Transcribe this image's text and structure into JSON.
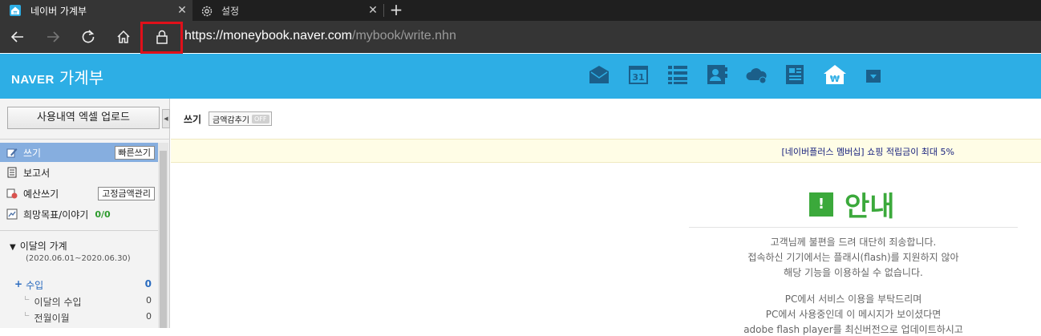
{
  "browser": {
    "tabs": [
      {
        "title": "네이버 가계부",
        "close": "✕"
      },
      {
        "title": "설정",
        "close": "✕"
      }
    ],
    "new_tab": "+",
    "url_host": "https://moneybook.naver.com",
    "url_path": "/mybook/write.nhn"
  },
  "header": {
    "brand": "NAVER",
    "product": "가계부",
    "icons": [
      "mail-icon",
      "calendar-icon",
      "list-icon",
      "contact-icon",
      "cloud-icon",
      "film-icon",
      "home-won-icon",
      "dropdown-icon"
    ],
    "calendar_day": "31",
    "home_symbol": "₩",
    "accent": "#2daee5"
  },
  "sidebar": {
    "upload_button": "사용내역 엑셀 업로드",
    "menu": [
      {
        "label": "쓰기",
        "button": "빠른쓰기"
      },
      {
        "label": "보고서"
      },
      {
        "label": "예산쓰기",
        "button": "고정금액관리"
      },
      {
        "label": "희망목표/이야기",
        "count": "0/0"
      }
    ],
    "month": {
      "title": "이달의 가계",
      "range": "(2020.06.01~2020.06.30)",
      "rows": [
        {
          "label": "수입",
          "value": "0"
        },
        {
          "label": "이달의 수입",
          "value": "0"
        },
        {
          "label": "전월이월",
          "value": "0"
        }
      ]
    }
  },
  "main": {
    "title": "쓰기",
    "toggle_label": "금액감추기",
    "toggle_state": "OFF",
    "banner": "[네이버플러스 멤버십] 쇼핑 적립금이 최대 5%",
    "notice_title": "안내",
    "notice_badge": "!",
    "messages": [
      "고객님께 불편을 드려 대단히 죄송합니다.",
      "접속하신 기기에서는 플래시(flash)를 지원하지 않아",
      "해당 기능을 이용하실 수 없습니다.",
      "PC에서 서비스 이용을 부탁드리며",
      "PC에서 사용중인데 이 메시지가 보이셨다면",
      "adobe flash player를 최신버전으로 업데이트하시고"
    ]
  }
}
